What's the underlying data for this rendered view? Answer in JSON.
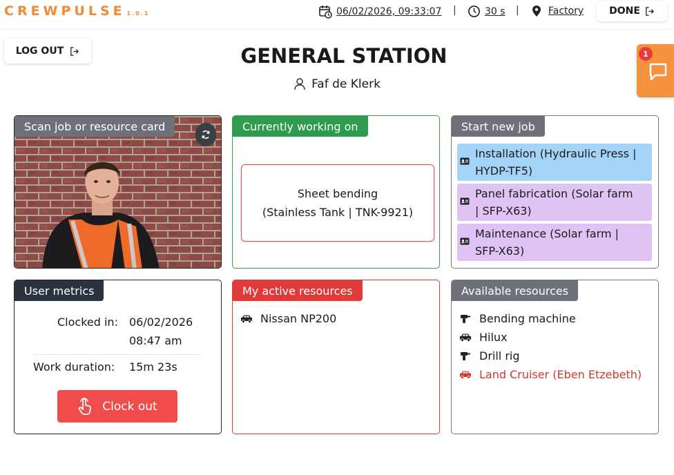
{
  "app": {
    "logo_text": "CREWPULSE",
    "version": "1.0.1"
  },
  "topbar": {
    "datetime": "06/02/2026, 09:33:07",
    "refresh": "30 s",
    "location": "Factory",
    "separator": "|",
    "done_label": "DONE"
  },
  "header": {
    "logout_label": "LOG OUT",
    "title": "GENERAL STATION",
    "user_name": "Faf de Klerk"
  },
  "chat": {
    "badge_count": "1"
  },
  "scan_panel": {
    "title": "Scan job or resource card"
  },
  "working_panel": {
    "title": "Currently working on",
    "job_line1": "Sheet bending",
    "job_line2": "(Stainless Tank | TNK-9921)"
  },
  "start_job_panel": {
    "title": "Start new job",
    "jobs": [
      {
        "line1": "Installation (Hydraulic Press |",
        "line2": "HYDP-TF5)",
        "color": "#a3d3f7"
      },
      {
        "line1": "Panel fabrication (Solar farm",
        "line2": "| SFP-X63)",
        "color": "#e0c3f5"
      },
      {
        "line1": "Maintenance (Solar farm |",
        "line2": "SFP-X63)",
        "color": "#e0c3f5"
      }
    ]
  },
  "metrics_panel": {
    "title": "User metrics",
    "clocked_in_label": "Clocked in:",
    "clocked_in_date": "06/02/2026",
    "clocked_in_time": "08:47 am",
    "duration_label": "Work duration:",
    "duration_value": "15m 23s",
    "clock_out_label": "Clock out"
  },
  "active_resources_panel": {
    "title": "My active resources",
    "items": [
      {
        "label": "Nissan NP200",
        "icon": "car-icon"
      }
    ]
  },
  "available_resources_panel": {
    "title": "Available resources",
    "items": [
      {
        "label": "Bending machine",
        "icon": "drill-icon",
        "color": "#1a1a1a"
      },
      {
        "label": "Hilux",
        "icon": "car-icon",
        "color": "#1a1a1a"
      },
      {
        "label": "Drill rig",
        "icon": "drill-icon",
        "color": "#1a1a1a"
      },
      {
        "label": "Land Cruiser (Eben Etzebeth)",
        "icon": "car-icon",
        "color": "#d0392f"
      }
    ]
  },
  "colors": {
    "brand_orange": "#f08a36",
    "green": "#2e9b4e",
    "red": "#e04a4a",
    "dark": "#2b3340",
    "gray": "#6e7179"
  }
}
